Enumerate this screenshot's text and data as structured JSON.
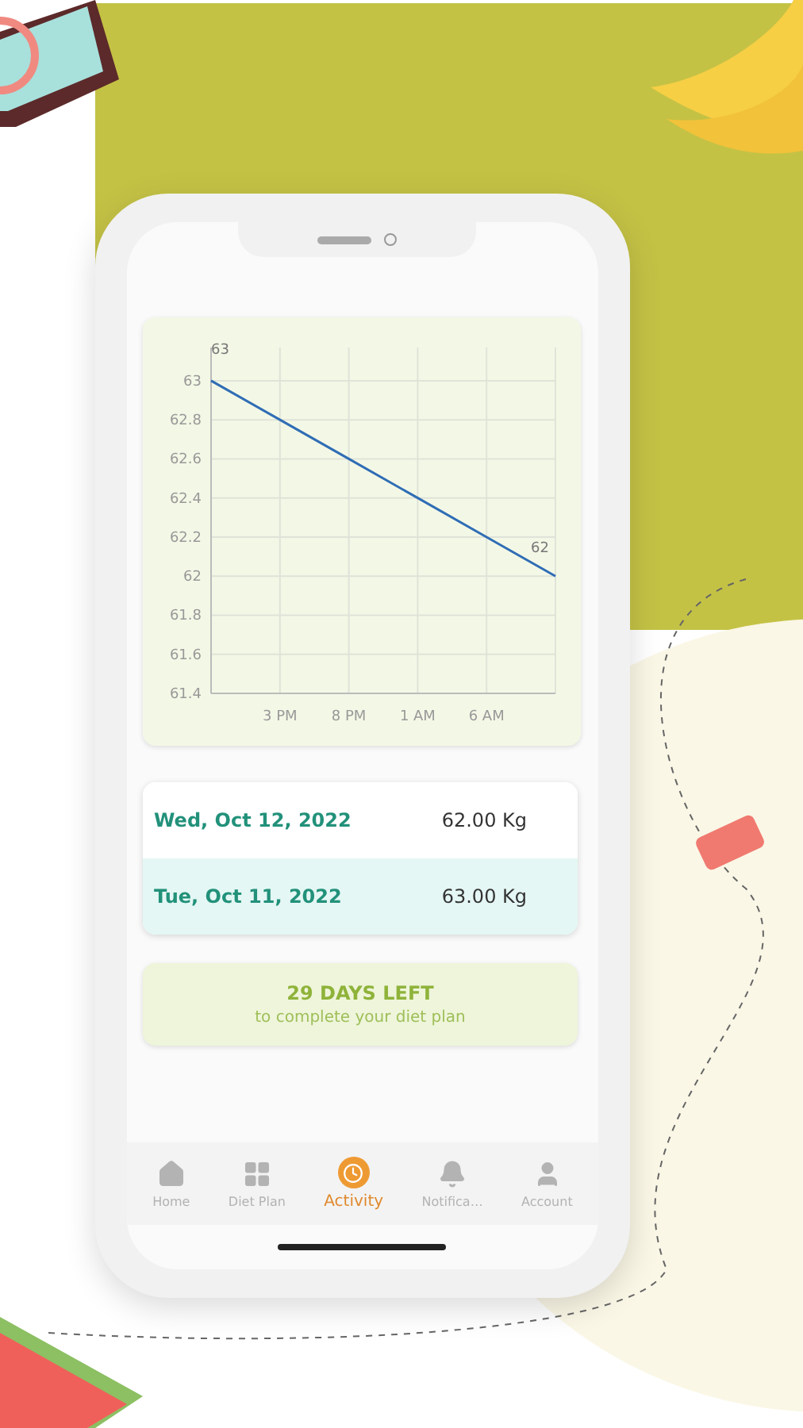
{
  "chart": {
    "chart_data": {
      "type": "line",
      "categories": [
        null,
        "3 PM",
        "8 PM",
        "1 AM",
        "6 AM",
        null
      ],
      "series": [
        {
          "color": "#2f6db5",
          "values": [
            63,
            62.8,
            62.6,
            62.4,
            62.2,
            62
          ]
        }
      ],
      "grid": true,
      "ylim": [
        61.4,
        63.17
      ],
      "yticks": [
        61.4,
        61.6,
        61.8,
        62,
        62.2,
        62.4,
        62.6,
        62.8,
        63
      ],
      "annotations": [
        {
          "y": 63,
          "text": "63"
        },
        {
          "y": 62,
          "text": "62"
        }
      ]
    }
  },
  "entries": [
    {
      "date": "Wed, Oct 12, 2022",
      "weight": "62.00 Kg",
      "selected": false
    },
    {
      "date": "Tue, Oct 11, 2022",
      "weight": "63.00 Kg",
      "selected": true
    }
  ],
  "countdown": {
    "title": "29 DAYS LEFT",
    "subtitle": "to complete your diet plan"
  },
  "tabs": [
    {
      "label": "Home",
      "kind": "home",
      "selected": false
    },
    {
      "label": "Diet Plan",
      "kind": "plan",
      "selected": false
    },
    {
      "label": "Activity",
      "kind": "activity",
      "selected": true
    },
    {
      "label": "Notifica…",
      "kind": "notifications",
      "selected": false
    },
    {
      "label": "Account",
      "kind": "account",
      "selected": false
    }
  ]
}
